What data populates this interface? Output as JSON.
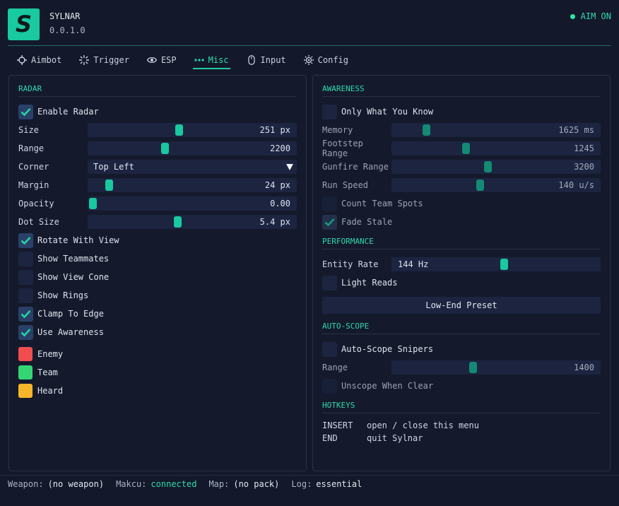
{
  "header": {
    "logo_letter": "S",
    "app_name": "SYLNAR",
    "version": "0.0.1.0",
    "aim_status": "AIM ON",
    "aim_status_color": "#2ee6a0"
  },
  "tabs": [
    {
      "label": "Aimbot",
      "icon": "crosshair-icon",
      "active": false
    },
    {
      "label": "Trigger",
      "icon": "spark-icon",
      "active": false
    },
    {
      "label": "ESP",
      "icon": "eye-icon",
      "active": false
    },
    {
      "label": "Misc",
      "icon": "dots-icon",
      "active": true
    },
    {
      "label": "Input",
      "icon": "mouse-icon",
      "active": false
    },
    {
      "label": "Config",
      "icon": "gear-icon",
      "active": false
    }
  ],
  "radar": {
    "title": "RADAR",
    "enable": {
      "label": "Enable Radar",
      "checked": true
    },
    "size": {
      "label": "Size",
      "value": "251 px",
      "fraction": 0.44
    },
    "range": {
      "label": "Range",
      "value": "2200",
      "fraction": 0.37
    },
    "corner": {
      "label": "Corner",
      "value": "Top Left"
    },
    "margin": {
      "label": "Margin",
      "value": "24 px",
      "fraction": 0.1
    },
    "opacity": {
      "label": "Opacity",
      "value": "0.00",
      "fraction": 0.0
    },
    "dot_size": {
      "label": "Dot Size",
      "value": "5.4 px",
      "fraction": 0.43
    },
    "options": [
      {
        "label": "Rotate With View",
        "checked": true
      },
      {
        "label": "Show Teammates",
        "checked": false
      },
      {
        "label": "Show View Cone",
        "checked": false
      },
      {
        "label": "Show Rings",
        "checked": false
      },
      {
        "label": "Clamp To Edge",
        "checked": true
      },
      {
        "label": "Use Awareness",
        "checked": true
      }
    ],
    "colors": [
      {
        "label": "Enemy",
        "color": "#f04e4e"
      },
      {
        "label": "Team",
        "color": "#33d672"
      },
      {
        "label": "Heard",
        "color": "#f6b62a"
      }
    ]
  },
  "awareness": {
    "title": "AWARENESS",
    "only_what_you_know": {
      "label": "Only What You Know",
      "checked": false
    },
    "memory": {
      "label": "Memory",
      "value": "1625 ms",
      "fraction": 0.15
    },
    "footstep_range": {
      "label": "Footstep Range",
      "value": "1245",
      "fraction": 0.33
    },
    "gunfire_range": {
      "label": "Gunfire Range",
      "value": "3200",
      "fraction": 0.46
    },
    "run_speed": {
      "label": "Run Speed",
      "value": "140 u/s",
      "fraction": 0.42
    },
    "count_team_spots": {
      "label": "Count Team Spots",
      "checked": false
    },
    "fade_stale": {
      "label": "Fade Stale",
      "checked": true
    }
  },
  "performance": {
    "title": "PERFORMANCE",
    "entity_rate": {
      "label": "Entity Rate",
      "value": "144 Hz",
      "fraction": 0.53
    },
    "light_reads": {
      "label": "Light Reads",
      "checked": false
    },
    "preset_button": "Low-End Preset"
  },
  "auto_scope": {
    "title": "AUTO-SCOPE",
    "snipers": {
      "label": "Auto-Scope Snipers",
      "checked": false
    },
    "range": {
      "label": "Range",
      "value": "1400",
      "fraction": 0.39
    },
    "unscope": {
      "label": "Unscope When Clear",
      "checked": false
    }
  },
  "hotkeys": {
    "title": "HOTKEYS",
    "items": [
      {
        "key": "INSERT",
        "action": "open / close this menu"
      },
      {
        "key": "END",
        "action": "quit Sylnar"
      }
    ]
  },
  "footer": {
    "weapon_label": "Weapon:",
    "weapon_value": "(no weapon)",
    "makcu_label": "Makcu:",
    "makcu_value": "connected",
    "map_label": "Map:",
    "map_value": "(no pack)",
    "log_label": "Log:",
    "log_value": "essential"
  },
  "accent_color": "#19c9a0"
}
